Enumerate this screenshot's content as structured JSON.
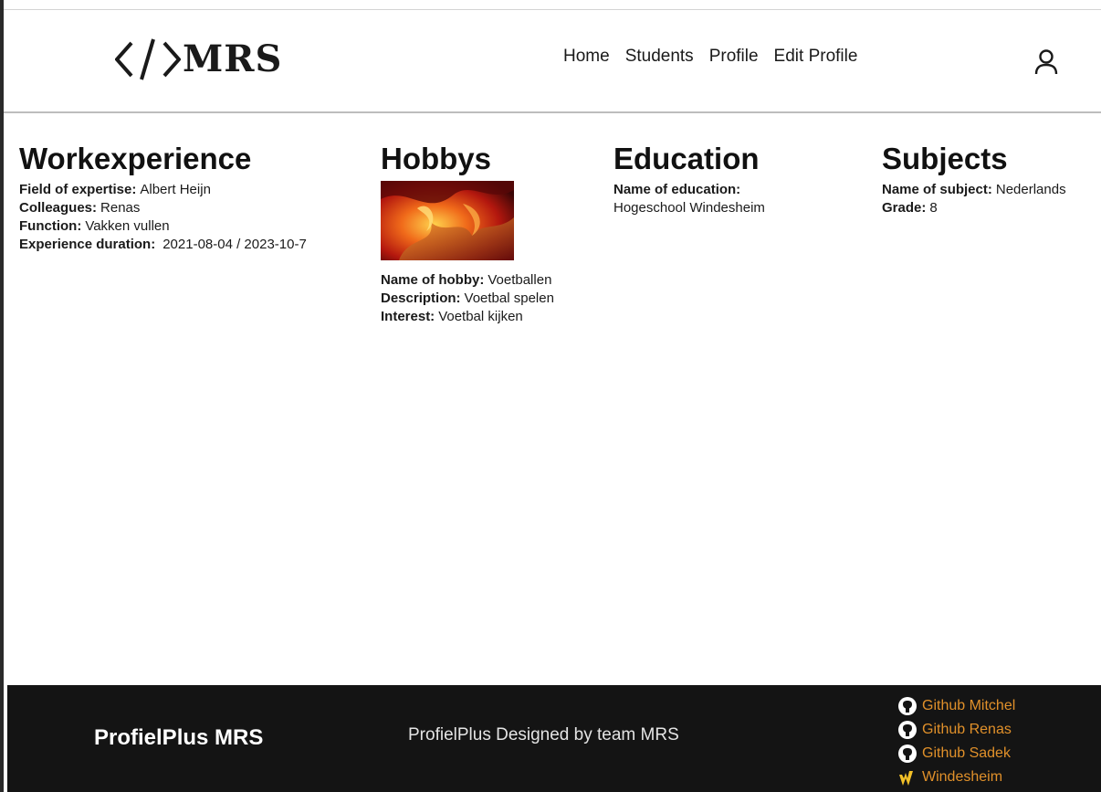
{
  "logo": {
    "symbol": "</>",
    "text": "MRS"
  },
  "nav": {
    "items": [
      {
        "label": "Home"
      },
      {
        "label": "Students"
      },
      {
        "label": "Profile"
      },
      {
        "label": "Edit Profile"
      }
    ],
    "user_icon": "user-icon"
  },
  "workexperience": {
    "title": "Workexperience",
    "fields": [
      {
        "label": "Field of expertise:",
        "value": "Albert Heijn"
      },
      {
        "label": "Colleagues:",
        "value": "Renas"
      },
      {
        "label": "Function:",
        "value": "Vakken vullen"
      },
      {
        "label": "Experience duration:",
        "value": "2021-08-04 / 2023-10-7"
      }
    ]
  },
  "hobbys": {
    "title": "Hobbys",
    "image_icon": "flame-image",
    "fields": [
      {
        "label": "Name of hobby:",
        "value": "Voetballen"
      },
      {
        "label": "Description:",
        "value": "Voetbal spelen"
      },
      {
        "label": "Interest:",
        "value": "Voetbal kijken"
      }
    ]
  },
  "education": {
    "title": "Education",
    "fields": [
      {
        "label": "Name of education:",
        "value": "Hogeschool Windesheim"
      }
    ]
  },
  "subjects": {
    "title": "Subjects",
    "fields": [
      {
        "label": "Name of subject:",
        "value": "Nederlands"
      },
      {
        "label": "Grade:",
        "value": "8"
      }
    ]
  },
  "footer": {
    "brand": "ProfielPlus MRS",
    "tagline": "ProfielPlus Designed by team MRS",
    "links": [
      {
        "label": "Github Mitchel",
        "icon": "github-icon"
      },
      {
        "label": "Github Renas",
        "icon": "github-icon"
      },
      {
        "label": "Github Sadek",
        "icon": "github-icon"
      },
      {
        "label": "Windesheim",
        "icon": "windesheim-icon"
      }
    ],
    "link_color": "#e0902a",
    "background": "#141414"
  }
}
